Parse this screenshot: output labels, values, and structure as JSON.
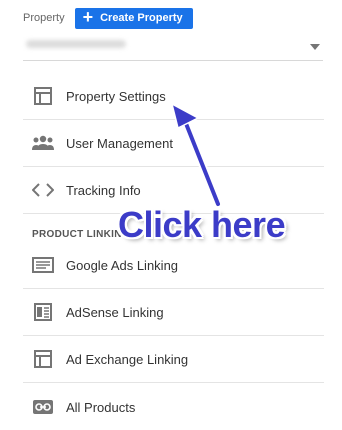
{
  "property": {
    "label": "Property",
    "create_button": "Create Property"
  },
  "menu": {
    "items": [
      {
        "label": "Property Settings",
        "icon": "property-settings-icon"
      },
      {
        "label": "User Management",
        "icon": "users-icon"
      },
      {
        "label": "Tracking Info",
        "icon": "code-icon"
      }
    ],
    "section_header": "PRODUCT LINKING",
    "linking_items": [
      {
        "label": "Google Ads Linking",
        "icon": "google-ads-icon"
      },
      {
        "label": "AdSense Linking",
        "icon": "adsense-icon"
      },
      {
        "label": "Ad Exchange Linking",
        "icon": "ad-exchange-icon"
      },
      {
        "label": "All Products",
        "icon": "link-icon"
      }
    ]
  },
  "annotation": {
    "text": "Click here",
    "color": "#3c3cc8"
  }
}
